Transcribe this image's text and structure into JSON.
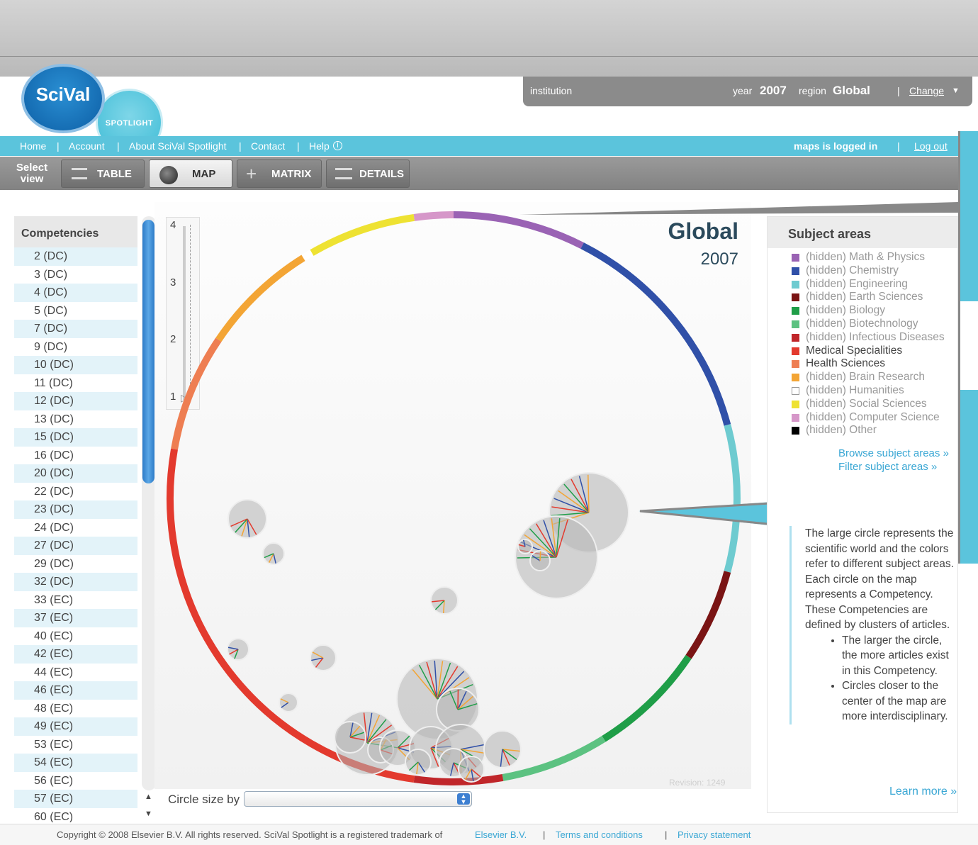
{
  "logo": {
    "primary": "SciVal",
    "secondary": "SPOTLIGHT"
  },
  "context_bar": {
    "institution_label": "institution",
    "year_label": "year",
    "year_value": "2007",
    "region_label": "region",
    "region_value": "Global",
    "change_link": "Change"
  },
  "nav": {
    "items": [
      "Home",
      "Account",
      "About SciVal Spotlight",
      "Contact",
      "Help"
    ],
    "separator": "|",
    "logged_in": "maps is logged in",
    "logout": "Log out"
  },
  "view_selector": {
    "label_line1": "Select",
    "label_line2": "view",
    "buttons": [
      "TABLE",
      "MAP",
      "MATRIX",
      "DETAILS"
    ],
    "active": "MAP"
  },
  "sidebar": {
    "title": "Competencies",
    "items": [
      "2 (DC)",
      "3 (DC)",
      "4 (DC)",
      "5 (DC)",
      "7 (DC)",
      "9 (DC)",
      "10 (DC)",
      "11 (DC)",
      "12 (DC)",
      "13 (DC)",
      "15 (DC)",
      "16 (DC)",
      "20 (DC)",
      "22 (DC)",
      "23 (DC)",
      "24 (DC)",
      "27 (DC)",
      "29 (DC)",
      "32 (DC)",
      "33 (EC)",
      "37 (EC)",
      "40 (EC)",
      "42 (EC)",
      "44 (EC)",
      "46 (EC)",
      "48 (EC)",
      "49 (EC)",
      "53 (EC)",
      "54 (EC)",
      "56 (EC)",
      "57 (EC)",
      "60 (EC)"
    ]
  },
  "zoom": {
    "ticks": [
      "4",
      "3",
      "2",
      "1"
    ],
    "value": 1
  },
  "map": {
    "title": "Global",
    "year": "2007",
    "revision": "Revision: 1249"
  },
  "subject_areas": {
    "title": "Subject areas",
    "items": [
      {
        "label": "(hidden) Math & Physics",
        "color": "#9a63b4",
        "hidden": true
      },
      {
        "label": "(hidden) Chemistry",
        "color": "#3050a8",
        "hidden": true
      },
      {
        "label": "(hidden) Engineering",
        "color": "#6ecbd0",
        "hidden": true
      },
      {
        "label": "(hidden) Earth Sciences",
        "color": "#7a1414",
        "hidden": true
      },
      {
        "label": "(hidden) Biology",
        "color": "#1f9e48",
        "hidden": true
      },
      {
        "label": "(hidden) Biotechnology",
        "color": "#5cc281",
        "hidden": true
      },
      {
        "label": "(hidden) Infectious Diseases",
        "color": "#c0262a",
        "hidden": true
      },
      {
        "label": "Medical Specialities",
        "color": "#e33a2e",
        "hidden": false
      },
      {
        "label": "Health Sciences",
        "color": "#ee7e52",
        "hidden": false
      },
      {
        "label": "(hidden) Brain Research",
        "color": "#f3a535",
        "hidden": true
      },
      {
        "label": "(hidden) Humanities",
        "color": "#ffffff",
        "hidden": true
      },
      {
        "label": "(hidden) Social Sciences",
        "color": "#eee232",
        "hidden": true
      },
      {
        "label": "(hidden) Computer Science",
        "color": "#d697c9",
        "hidden": true
      },
      {
        "label": "(hidden) Other",
        "color": "#000000",
        "hidden": true
      }
    ],
    "browse_link": "Browse subject areas »",
    "filter_link": "Filter subject areas »"
  },
  "description": {
    "text": "The large circle represents the scientific world and the colors refer to different subject areas. Each circle on the map represents a Competency. These Competencies are defined by clusters of articles.",
    "bullets": [
      "The larger the circle, the more articles exist in this Competency.",
      "Circles closer to the center of the map are more interdisciplinary."
    ],
    "learn_more": "Learn more »"
  },
  "circle_size": {
    "label": "Circle size by",
    "value": ""
  },
  "footer": {
    "copyright": "Copyright © 2008 Elsevier B.V. All rights reserved. SciVal Spotlight is a registered trademark of",
    "elsevier_link": "Elsevier B.V.",
    "terms": "Terms and conditions",
    "privacy": "Privacy statement",
    "separator": "|"
  }
}
